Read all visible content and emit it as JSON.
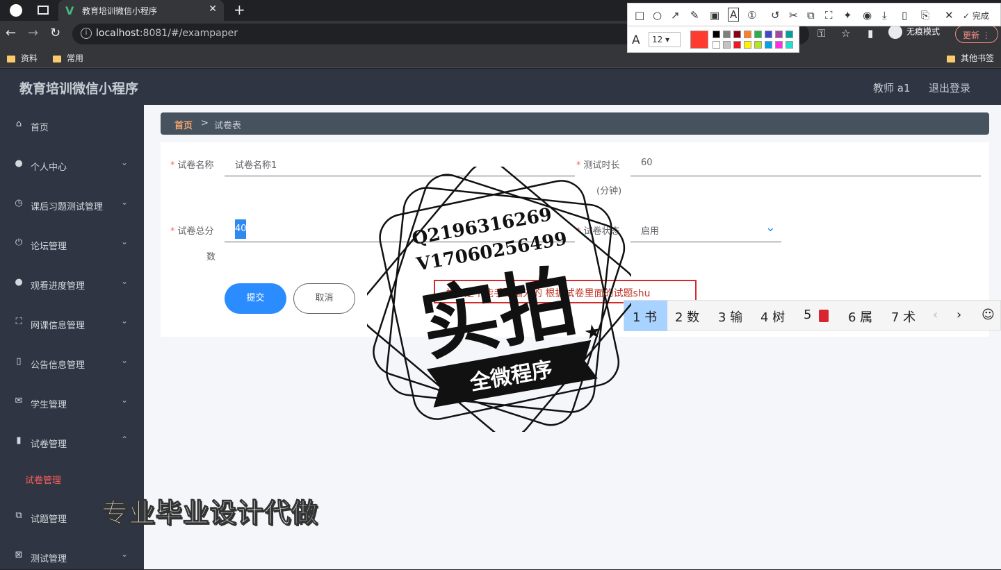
{
  "browser": {
    "tab_title": "教育培训微信小程序",
    "url_host": "localhost",
    "url_rest": ":8081/#/exampaper",
    "bookmarks": [
      "资料",
      "常用"
    ],
    "other_bookmarks": "其他书签",
    "incognito_label": "无痕模式",
    "update_label": "更新"
  },
  "annotation_toolbar": {
    "font_size": "12",
    "done_label": "完成",
    "selected_color": "#ff3b30"
  },
  "app": {
    "title": "教育培训微信小程序",
    "user": "教师 a1",
    "logout": "退出登录"
  },
  "sidebar": {
    "items": [
      {
        "label": "首页",
        "icon": "home-icon",
        "expandable": false
      },
      {
        "label": "个人中心",
        "icon": "user-icon",
        "expandable": true
      },
      {
        "label": "课后习题测试管理",
        "icon": "clock-icon",
        "expandable": true
      },
      {
        "label": "论坛管理",
        "icon": "power-icon",
        "expandable": true
      },
      {
        "label": "观看进度管理",
        "icon": "user-icon",
        "expandable": true
      },
      {
        "label": "网课信息管理",
        "icon": "frame-icon",
        "expandable": true
      },
      {
        "label": "公告信息管理",
        "icon": "mic-icon",
        "expandable": true
      },
      {
        "label": "学生管理",
        "icon": "mail-icon",
        "expandable": true
      },
      {
        "label": "试卷管理",
        "icon": "chart-icon",
        "expandable": true,
        "open": true
      },
      {
        "label": "试题管理",
        "icon": "copy-icon",
        "expandable": false
      },
      {
        "label": "测试管理",
        "icon": "delete-icon",
        "expandable": true
      }
    ],
    "active_subitem": "试卷管理"
  },
  "breadcrumb": {
    "home": "首页",
    "separator": ">",
    "current": "试卷表"
  },
  "form": {
    "name_label": "试卷名称",
    "name_value": "试卷名称1",
    "duration_label": "测试时长",
    "duration_unit": "(分钟)",
    "duration_value": "60",
    "score_label": "试卷总分",
    "score_label_cont": "数",
    "score_value": "40",
    "status_label": "试卷状态",
    "status_value": "启用",
    "submit": "提交",
    "cancel": "取消"
  },
  "ime": {
    "input_text": "总分是不能手动输入的 根据试卷里面的试题shu",
    "candidates": [
      "1 书",
      "2 数",
      "3 输",
      "4 树",
      "5",
      "6 属",
      "7 术"
    ]
  },
  "watermark": {
    "contact_q": "Q2196316269",
    "contact_v": "V17060256499",
    "big_text": "实拍",
    "banner": "全微程序",
    "bottom": "专业毕业设计代做"
  }
}
